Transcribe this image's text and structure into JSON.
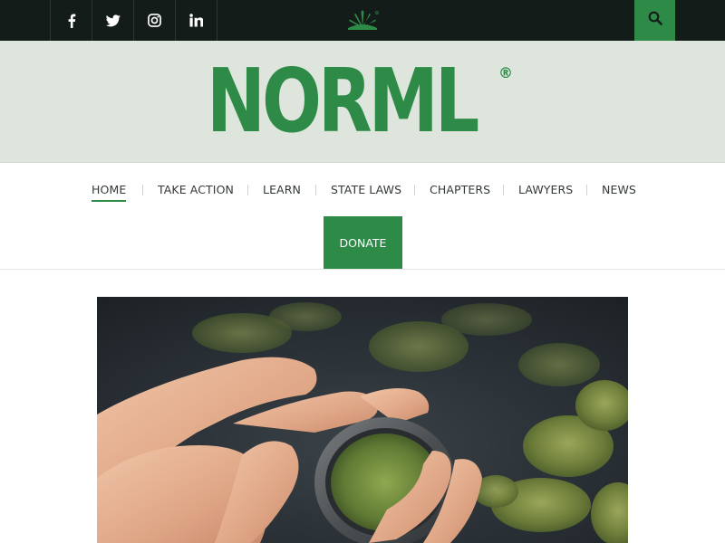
{
  "topbar": {
    "social": [
      {
        "name": "facebook-icon",
        "glyph": "f"
      },
      {
        "name": "twitter-icon",
        "glyph": "twitter"
      },
      {
        "name": "instagram-icon",
        "glyph": "instagram"
      },
      {
        "name": "linkedin-icon",
        "glyph": "in"
      }
    ],
    "center_icon": "cannabis-leaf-icon",
    "search_icon": "search-icon"
  },
  "logo": {
    "text": "NORML",
    "registered": "®"
  },
  "nav": {
    "items": [
      {
        "label": "HOME",
        "active": true
      },
      {
        "label": "TAKE ACTION",
        "active": false
      },
      {
        "label": "LEARN",
        "active": false
      },
      {
        "label": "STATE LAWS",
        "active": false
      },
      {
        "label": "CHAPTERS",
        "active": false
      },
      {
        "label": "LAWYERS",
        "active": false
      },
      {
        "label": "NEWS",
        "active": false
      }
    ],
    "donate_label": "DONATE"
  },
  "hero": {
    "image": "hand-holding-grinder-photo"
  },
  "colors": {
    "brand_green": "#2e8b47",
    "topbar_bg": "#141c19",
    "logo_band_bg": "#dde5dc"
  }
}
